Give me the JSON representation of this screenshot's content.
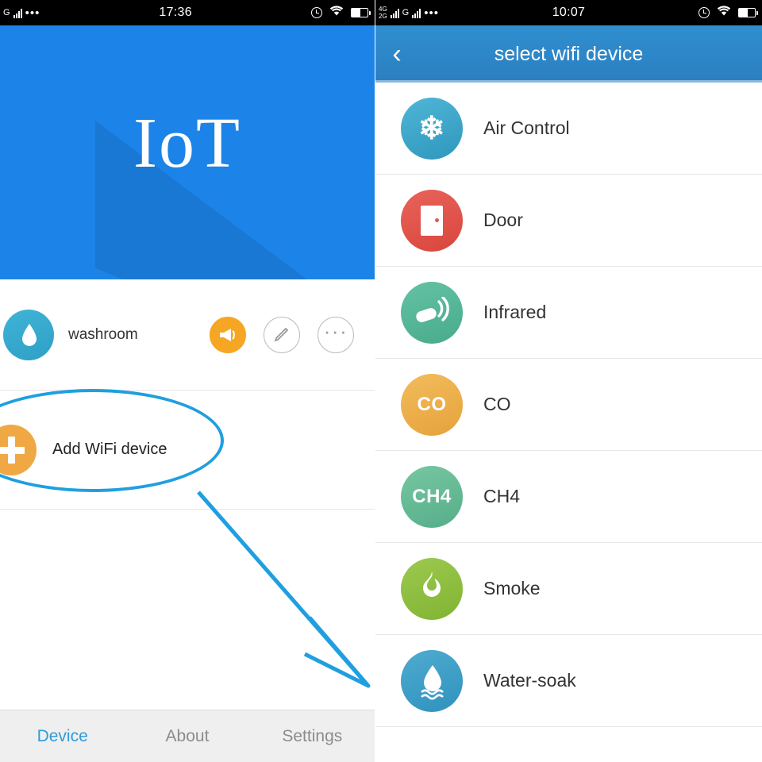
{
  "left_phone": {
    "status_bar": {
      "sim_label": "G",
      "dots": "•••",
      "time": "17:36",
      "alarm_icon": "alarm-clock-icon",
      "wifi_icon": "wifi-icon",
      "battery_icon": "battery-icon"
    },
    "hero": {
      "logo": "IoT"
    },
    "device_row": {
      "icon": "water-drop-icon",
      "name": "washroom",
      "actions": [
        {
          "name": "notify-button",
          "icon": "megaphone-icon"
        },
        {
          "name": "edit-button",
          "icon": "pencil-icon"
        },
        {
          "name": "more-button",
          "icon": "ellipsis-icon"
        }
      ]
    },
    "add_row": {
      "icon": "plus-icon",
      "label": "Add WiFi device"
    },
    "annotations": {
      "ellipse": "highlight-ellipse",
      "arrow": "pointer-arrow"
    },
    "tabs": [
      {
        "label": "Device",
        "active": true
      },
      {
        "label": "About",
        "active": false
      },
      {
        "label": "Settings",
        "active": false
      }
    ]
  },
  "right_phone": {
    "status_bar": {
      "net_top": "4G",
      "net_bottom": "2G",
      "sim_label": "G",
      "dots": "•••",
      "time": "10:07",
      "alarm_icon": "alarm-clock-icon",
      "wifi_icon": "wifi-icon",
      "battery_icon": "battery-icon"
    },
    "title_bar": {
      "back": "‹",
      "title": "select wifi device"
    },
    "devices": [
      {
        "label": "Air Control",
        "icon": "snowflake-icon",
        "color": "#3fa8cb",
        "glyph": "❄"
      },
      {
        "label": "Door",
        "icon": "door-icon",
        "color": "#e2564d",
        "glyph": ""
      },
      {
        "label": "Infrared",
        "icon": "remote-icon",
        "color": "#56b89a",
        "glyph": ""
      },
      {
        "label": "CO",
        "icon": "co-icon",
        "color": "#eeb04a",
        "glyph": "CO"
      },
      {
        "label": "CH4",
        "icon": "ch4-icon",
        "color": "#66bb96",
        "glyph": "CH4"
      },
      {
        "label": "Smoke",
        "icon": "flame-icon",
        "color": "#8ebf3f",
        "glyph": "🔥"
      },
      {
        "label": "Water-soak",
        "icon": "water-drop-icon",
        "color": "#3f9fcb",
        "glyph": ""
      }
    ]
  }
}
